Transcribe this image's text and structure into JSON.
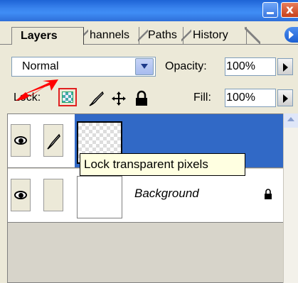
{
  "window": {
    "minimize_icon": "minimize-icon",
    "close_glyph": "x"
  },
  "tabs": [
    {
      "label": "Layers",
      "active": true
    },
    {
      "label": "Channels",
      "shown": "hannels"
    },
    {
      "label": "Paths",
      "shown": "Paths"
    },
    {
      "label": "History",
      "shown": "History"
    }
  ],
  "options": {
    "blend_mode": "Normal",
    "opacity_label": "Opacity:",
    "opacity_value": "100%",
    "lock_label": "Lock:",
    "fill_label": "Fill:",
    "fill_value": "100%"
  },
  "lock_icons": [
    "lock-transparent-pixels-icon",
    "lock-image-pixels-icon",
    "lock-position-icon",
    "lock-all-icon"
  ],
  "layers": [
    {
      "name": "",
      "selected": true,
      "visible": true,
      "brush": true
    },
    {
      "name": "Background",
      "selected": false,
      "visible": true,
      "locked": true
    }
  ],
  "tooltip": "Lock transparent pixels",
  "colors": {
    "accent": "#3169c6",
    "title": "#2f6fd9",
    "highlight": "#e02020"
  }
}
